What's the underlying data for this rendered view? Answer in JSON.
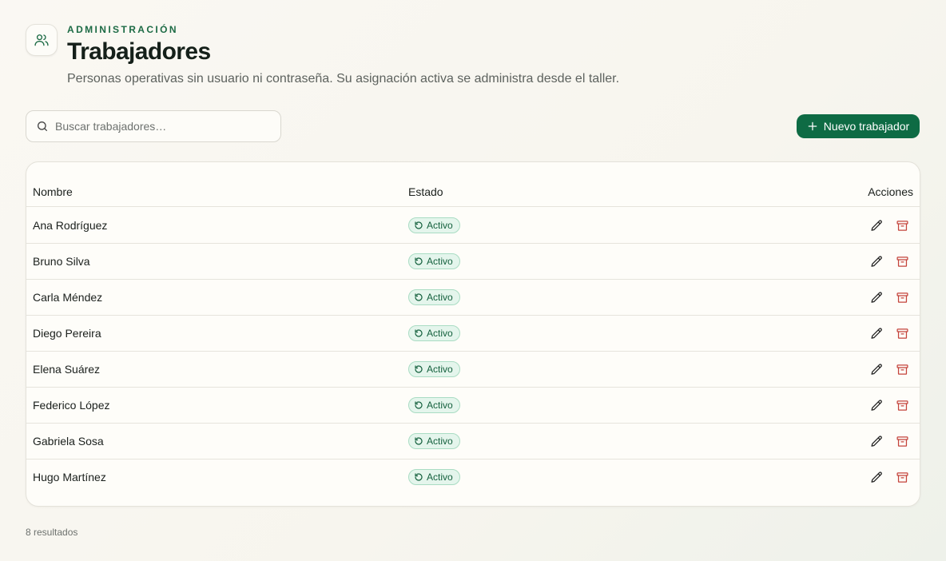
{
  "header": {
    "eyebrow": "ADMINISTRACIÓN",
    "title": "Trabajadores",
    "subtitle": "Personas operativas sin usuario ni contraseña. Su asignación activa se administra desde el taller.",
    "icon": "users-icon"
  },
  "search": {
    "placeholder": "Buscar trabajadores…",
    "value": "",
    "icon": "search-icon"
  },
  "toolbar": {
    "new_label": "Nuevo trabajador",
    "new_icon": "plus-icon"
  },
  "table": {
    "columns": {
      "name": "Nombre",
      "state": "Estado",
      "actions": "Acciones"
    },
    "rows": [
      {
        "name": "Ana Rodríguez",
        "state": "Activo"
      },
      {
        "name": "Bruno Silva",
        "state": "Activo"
      },
      {
        "name": "Carla Méndez",
        "state": "Activo"
      },
      {
        "name": "Diego Pereira",
        "state": "Activo"
      },
      {
        "name": "Elena Suárez",
        "state": "Activo"
      },
      {
        "name": "Federico López",
        "state": "Activo"
      },
      {
        "name": "Gabriela Sosa",
        "state": "Activo"
      },
      {
        "name": "Hugo Martínez",
        "state": "Activo"
      }
    ],
    "row_action_icons": [
      "pencil-icon",
      "archive-icon"
    ]
  },
  "footer": {
    "results": "8 resultados"
  },
  "colors": {
    "accent": "#0e6b44",
    "eyebrow": "#1d6b45",
    "badge_bg": "#e4f5ec",
    "badge_border": "#a9dcc3",
    "danger": "#c4433b"
  }
}
